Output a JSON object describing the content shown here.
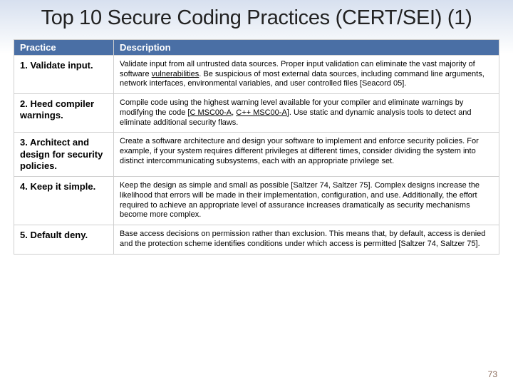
{
  "title": "Top 10 Secure Coding Practices (CERT/SEI) (1)",
  "headers": {
    "practice": "Practice",
    "description": "Description"
  },
  "rows": [
    {
      "practice": "1. Validate input.",
      "desc_pre": "Validate input from all untrusted data sources. Proper input validation can eliminate the vast majority of software ",
      "desc_link1": "vulnerabilities",
      "desc_post": ". Be suspicious of most external data sources, including command line arguments, network interfaces, environmental variables, and user controlled files [Seacord 05]."
    },
    {
      "practice": "2. Heed compiler warnings.",
      "desc_pre": "Compile code using the highest warning level available for your compiler and eliminate warnings by modifying the code [",
      "desc_link1": "C MSC00-A",
      "desc_mid": ", ",
      "desc_link2": "C++ MSC00-A",
      "desc_post": "]. Use static and dynamic analysis tools to detect and eliminate additional security flaws."
    },
    {
      "practice": "3. Architect and design for security policies.",
      "desc_pre": "Create a software architecture and design your software to implement and enforce security policies. For example, if your system requires different privileges at different times, consider dividing the system into distinct intercommunicating subsystems, each with an appropriate privilege set.",
      "desc_link1": "",
      "desc_mid": "",
      "desc_link2": "",
      "desc_post": ""
    },
    {
      "practice": "4. Keep it simple.",
      "desc_pre": "Keep the design as simple and small as possible [Saltzer 74, Saltzer 75]. Complex designs increase the likelihood that errors will be made in their implementation, configuration, and use. Additionally, the effort required to achieve an appropriate level of assurance increases dramatically as security mechanisms become more complex.",
      "desc_link1": "",
      "desc_mid": "",
      "desc_link2": "",
      "desc_post": ""
    },
    {
      "practice": "5. Default deny.",
      "desc_pre": "Base access decisions on permission rather than exclusion. This means that, by default, access is denied and the protection scheme identifies conditions under which access is permitted [Saltzer 74, Saltzer 75].",
      "desc_link1": "",
      "desc_mid": "",
      "desc_link2": "",
      "desc_post": ""
    }
  ],
  "page_number": "73"
}
